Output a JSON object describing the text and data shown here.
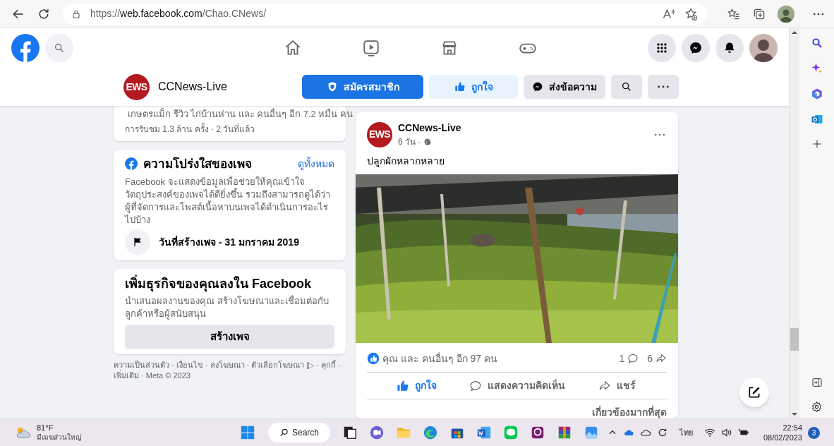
{
  "browser": {
    "url_prefix": "https://",
    "url_host": "web.facebook.com",
    "url_path": "/Chao.CNews/"
  },
  "nav": {
    "tabs": [
      {
        "kind": "home",
        "selected": false
      },
      {
        "kind": "video",
        "selected": false
      },
      {
        "kind": "market",
        "selected": false
      },
      {
        "kind": "gaming",
        "selected": false
      }
    ]
  },
  "page_header": {
    "avatar_text": "EWS",
    "name": "CCNews-Live",
    "buttons": [
      {
        "kind": "subscribe",
        "label": "สมัครสมาชิก"
      },
      {
        "kind": "like",
        "label": "ถูกใจ"
      },
      {
        "kind": "message",
        "label": "ส่งข้อความ"
      },
      {
        "kind": "search"
      },
      {
        "kind": "more"
      }
    ]
  },
  "previous_card": {
    "reactions": "เกษตรแม็ก รีวิว ไก่บ้านห่าน และ คนอื่นๆ อีก 7.2 หมื่น คน",
    "views": "การรับชม 1.3 ล้าน ครั้ง · 2 วันที่แล้ว"
  },
  "transparency": {
    "title": "ความโปร่งใสของเพจ",
    "see_all": "ดูทั้งหมด",
    "description": "Facebook จะแสดงข้อมูลเพื่อช่วยให้คุณเข้าใจวัตถุประสงค์ของเพจได้ดียิ่งขึ้น รวมถึงสามารถดูได้ว่าผู้ที่จัดการและโพสต์เนื้อหาบนเพจได้ดำเนินการอะไรไปบ้าง",
    "created": "วันที่สร้างเพจ - 31 มกราคม 2019"
  },
  "business": {
    "title": "เพิ่มธุรกิจของคุณลงใน Facebook",
    "description": "นำเสนอผลงานของคุณ สร้างโฆษณาและเชื่อมต่อกับลูกค้าหรือผู้สนับสนุน",
    "button": "สร้างเพจ"
  },
  "footer": "ความเป็นส่วนตัว · เงื่อนไข · ลงโฆษณา · ตัวเลือกโฆษณา [▷ · คุกกี้ · เพิ่มเติม · Meta © 2023",
  "post": {
    "avatar_text": "EWS",
    "author": "CCNews-Live",
    "time": "6 วัน ·",
    "text": "ปลูกผักหลากหลาย",
    "reactions": "คุณ และ คนอื่นๆ อีก 97 คน",
    "comments": "1",
    "shares": "6",
    "actions": [
      {
        "kind": "like",
        "label": "ถูกใจ",
        "selected": true
      },
      {
        "kind": "comment",
        "label": "แสดงความคิดเห็น",
        "selected": false
      },
      {
        "kind": "share",
        "label": "แชร์",
        "selected": false
      }
    ],
    "sort": "เกี่ยวข้องมากที่สุด"
  },
  "taskbar": {
    "temperature": "81°F",
    "weather": "มีเมฆส่วนใหญ่",
    "search": "Search",
    "language": "ไทย",
    "time": "22:54",
    "date": "08/02/2023",
    "notifications": "3"
  }
}
